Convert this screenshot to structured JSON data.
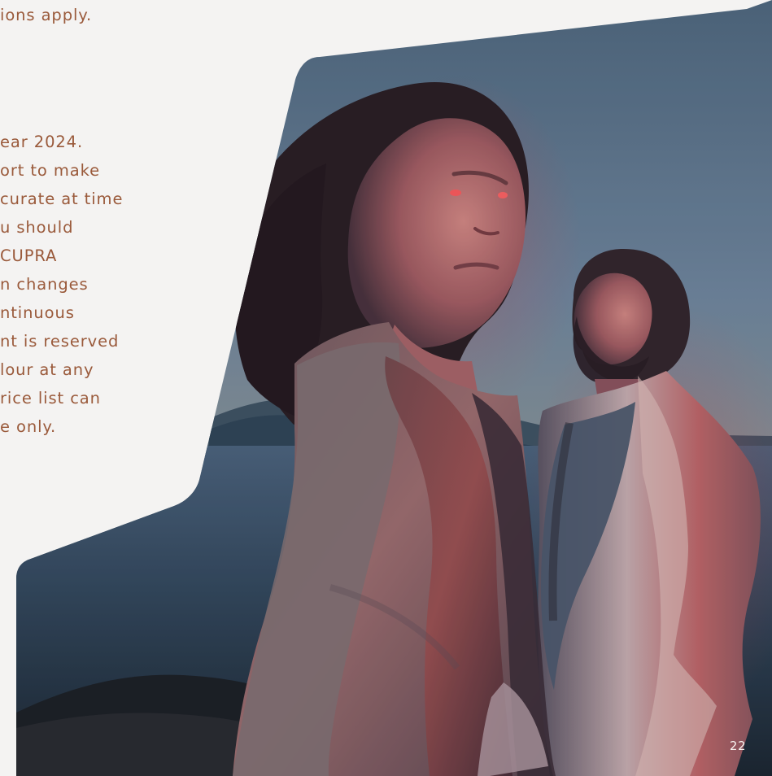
{
  "text_lines": [
    "ions apply.",
    "ear 2024.",
    "ort to make",
    "curate at time",
    "u should",
    "CUPRA",
    "n changes",
    "ntinuous",
    "nt is reserved",
    "lour at any",
    "rice list can",
    "e only."
  ],
  "page_number": "22",
  "colors": {
    "background": "#f4f3f2",
    "text": "#9a5a3b",
    "page_number": "#f7f1ee"
  }
}
